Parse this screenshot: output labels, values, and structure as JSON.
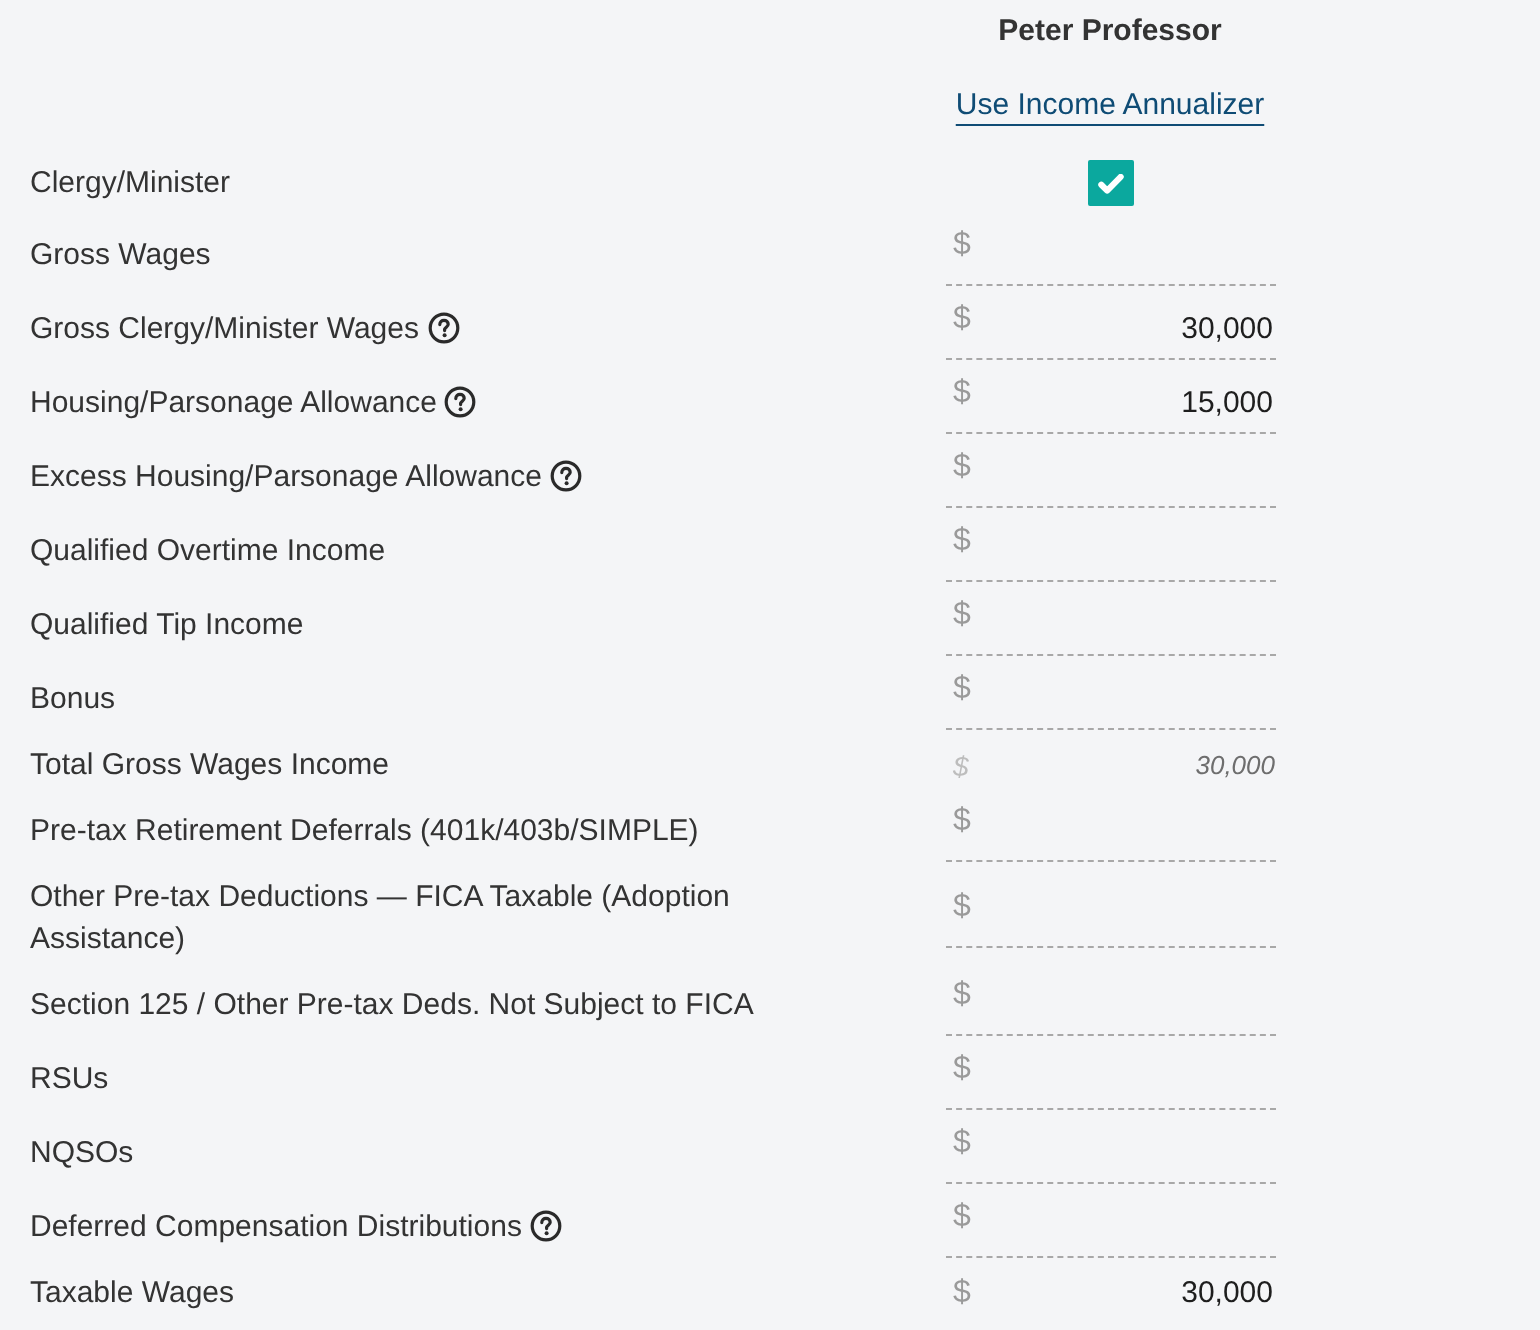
{
  "header": {
    "name": "Peter Professor",
    "link": "Use Income Annualizer"
  },
  "rows": [
    {
      "kind": "checkbox",
      "label": "Clergy/Minister",
      "help": false,
      "checked": true
    },
    {
      "kind": "input",
      "label": "Gross Wages",
      "help": false,
      "currency": "$"
    },
    {
      "kind": "input",
      "label": "Gross Clergy/Minister Wages",
      "help": true,
      "currency": "$",
      "value": "30,000"
    },
    {
      "kind": "input",
      "label": "Housing/Parsonage Allowance",
      "help": true,
      "currency": "$",
      "value": "15,000"
    },
    {
      "kind": "input",
      "label": "Excess Housing/Parsonage Allowance",
      "help": true,
      "currency": "$"
    },
    {
      "kind": "input",
      "label": "Qualified Overtime Income",
      "help": false,
      "currency": "$"
    },
    {
      "kind": "input",
      "label": "Qualified Tip Income",
      "help": false,
      "currency": "$"
    },
    {
      "kind": "input",
      "label": "Bonus",
      "help": false,
      "currency": "$"
    },
    {
      "kind": "subtotal",
      "label": "Total Gross Wages Income",
      "help": false,
      "currency": "$",
      "value": "30,000"
    },
    {
      "kind": "input",
      "label": "Pre-tax Retirement Deferrals (401k/403b/SIMPLE)",
      "help": false,
      "currency": "$"
    },
    {
      "kind": "input",
      "label": "Other Pre-tax Deductions — FICA Taxable (Adoption Assistance)",
      "help": false,
      "currency": "$"
    },
    {
      "kind": "input",
      "label": "Section 125 / Other Pre-tax Deds. Not Subject to FICA",
      "help": false,
      "currency": "$"
    },
    {
      "kind": "input",
      "label": "RSUs",
      "help": false,
      "currency": "$"
    },
    {
      "kind": "input",
      "label": "NQSOs",
      "help": false,
      "currency": "$"
    },
    {
      "kind": "input",
      "label": "Deferred Compensation Distributions",
      "help": true,
      "currency": "$"
    },
    {
      "kind": "total",
      "label": "Taxable Wages",
      "help": false,
      "currency": "$",
      "value": "30,000"
    }
  ]
}
